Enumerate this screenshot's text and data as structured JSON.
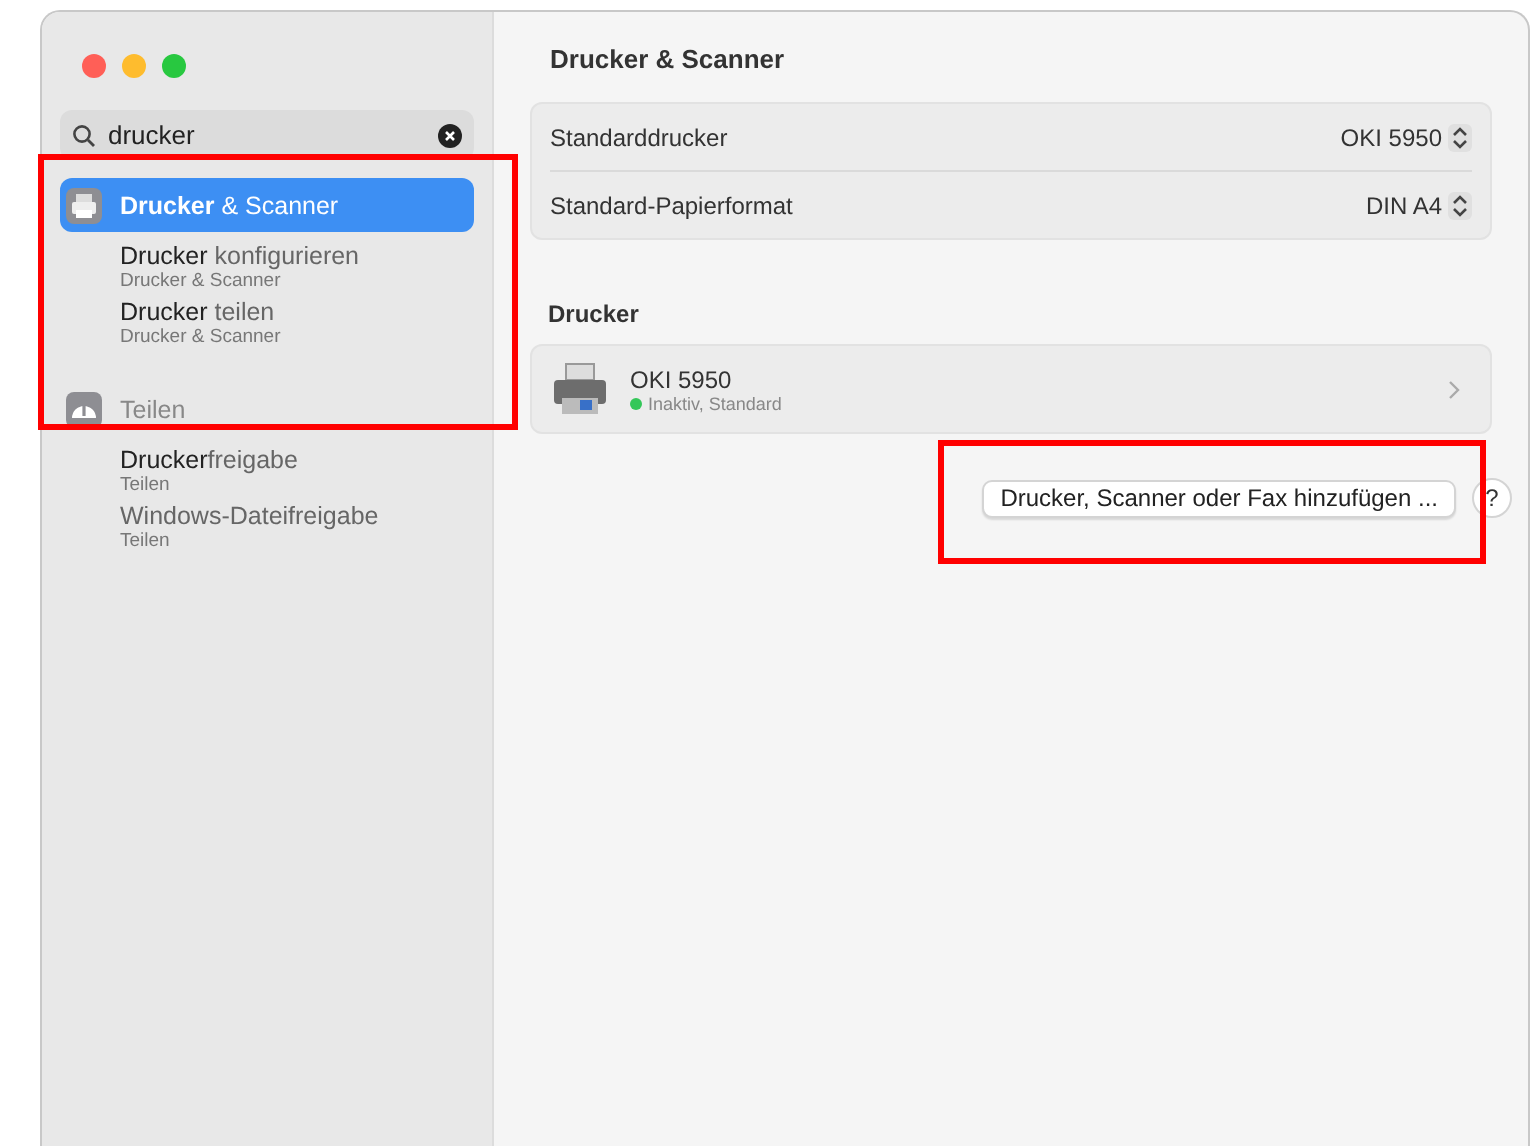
{
  "window": {
    "title": "Drucker & Scanner"
  },
  "search": {
    "value": "drucker"
  },
  "sidebar": {
    "sections": [
      {
        "title": "**Drucker** & Scanner",
        "kind": "printer",
        "selected": true,
        "children": [
          {
            "title": "**Drucker** konfigurieren",
            "subtitle": "Drucker & Scanner",
            "selected": false
          },
          {
            "title": "**Drucker** teilen",
            "subtitle": "Drucker & Scanner",
            "selected": false
          }
        ]
      },
      {
        "title": "Teilen",
        "kind": "sharing",
        "selected": false,
        "children": [
          {
            "title": "**Drucker**freigabe",
            "subtitle": "Teilen",
            "selected": false
          },
          {
            "title": "Windows-Dateifreigabe",
            "subtitle": "Teilen",
            "selected": false
          }
        ]
      }
    ]
  },
  "settings": [
    {
      "label": "Standarddrucker",
      "value": "OKI 5950"
    },
    {
      "label": "Standard-Papierformat",
      "value": "DIN A4"
    }
  ],
  "printers_heading": "Drucker",
  "printers": [
    {
      "name": "OKI 5950",
      "status": "Inaktiv, Standard",
      "color": "#34c759"
    }
  ],
  "add_button": "Drucker, Scanner oder Fax hinzufügen ...",
  "help_button": "?"
}
